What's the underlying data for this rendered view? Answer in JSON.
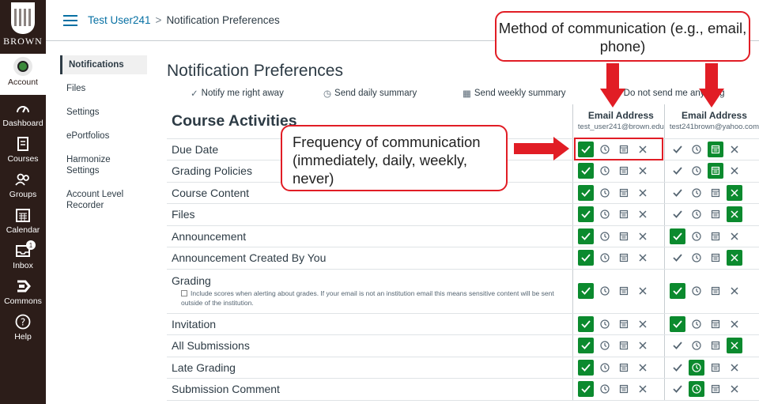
{
  "nav": {
    "logo_word": "BROWN",
    "items": [
      {
        "label": "Account",
        "icon": "account-avatar-icon"
      },
      {
        "label": "Dashboard",
        "icon": "dashboard-icon"
      },
      {
        "label": "Courses",
        "icon": "courses-icon"
      },
      {
        "label": "Groups",
        "icon": "groups-icon"
      },
      {
        "label": "Calendar",
        "icon": "calendar-icon"
      },
      {
        "label": "Inbox",
        "icon": "inbox-icon",
        "badge": "1"
      },
      {
        "label": "Commons",
        "icon": "commons-icon"
      },
      {
        "label": "Help",
        "icon": "help-icon"
      }
    ]
  },
  "header": {
    "user_link": "Test User241",
    "separator": ">",
    "current": "Notification Preferences"
  },
  "course_nav": [
    "Notifications",
    "Files",
    "Settings",
    "ePortfolios",
    "Harmonize Settings",
    "Account Level Recorder"
  ],
  "page": {
    "title": "Notification Preferences",
    "legend": [
      {
        "glyph": "✓",
        "label": "Notify me right away"
      },
      {
        "glyph": "◷",
        "label": "Send daily summary"
      },
      {
        "glyph": "▦",
        "label": "Send weekly summary"
      },
      {
        "glyph": "✕",
        "label": "Do not send me anything"
      }
    ],
    "section_title": "Course Activities",
    "channels": [
      {
        "type": "Email Address",
        "address": "test_user241@brown.edu"
      },
      {
        "type": "Email Address",
        "address": "test241brown@yahoo.com"
      }
    ],
    "grading_note": "Include scores when alerting about grades. If your email is not an institution email this means sensitive content will be sent outside of the institution.",
    "rows": [
      {
        "name": "Due Date",
        "sel": [
          0,
          2
        ]
      },
      {
        "name": "Grading Policies",
        "sel": [
          0,
          2
        ]
      },
      {
        "name": "Course Content",
        "sel": [
          0,
          3
        ]
      },
      {
        "name": "Files",
        "sel": [
          0,
          3
        ]
      },
      {
        "name": "Announcement",
        "sel": [
          0,
          0
        ]
      },
      {
        "name": "Announcement Created By You",
        "sel": [
          0,
          3
        ]
      },
      {
        "name": "Grading",
        "sel": [
          0,
          0
        ],
        "note": true
      },
      {
        "name": "Invitation",
        "sel": [
          0,
          0
        ]
      },
      {
        "name": "All Submissions",
        "sel": [
          0,
          3
        ]
      },
      {
        "name": "Late Grading",
        "sel": [
          0,
          1
        ]
      },
      {
        "name": "Submission Comment",
        "sel": [
          0,
          1
        ]
      }
    ]
  },
  "annotations": {
    "method": "Method of communication (e.g., email, phone)",
    "frequency": "Frequency of communication (immediately, daily, weekly, never)"
  },
  "colors": {
    "nav_bg": "#2c1d19",
    "link": "#0770a3",
    "selected": "#0b8a2e",
    "annotation": "#e11d25"
  }
}
